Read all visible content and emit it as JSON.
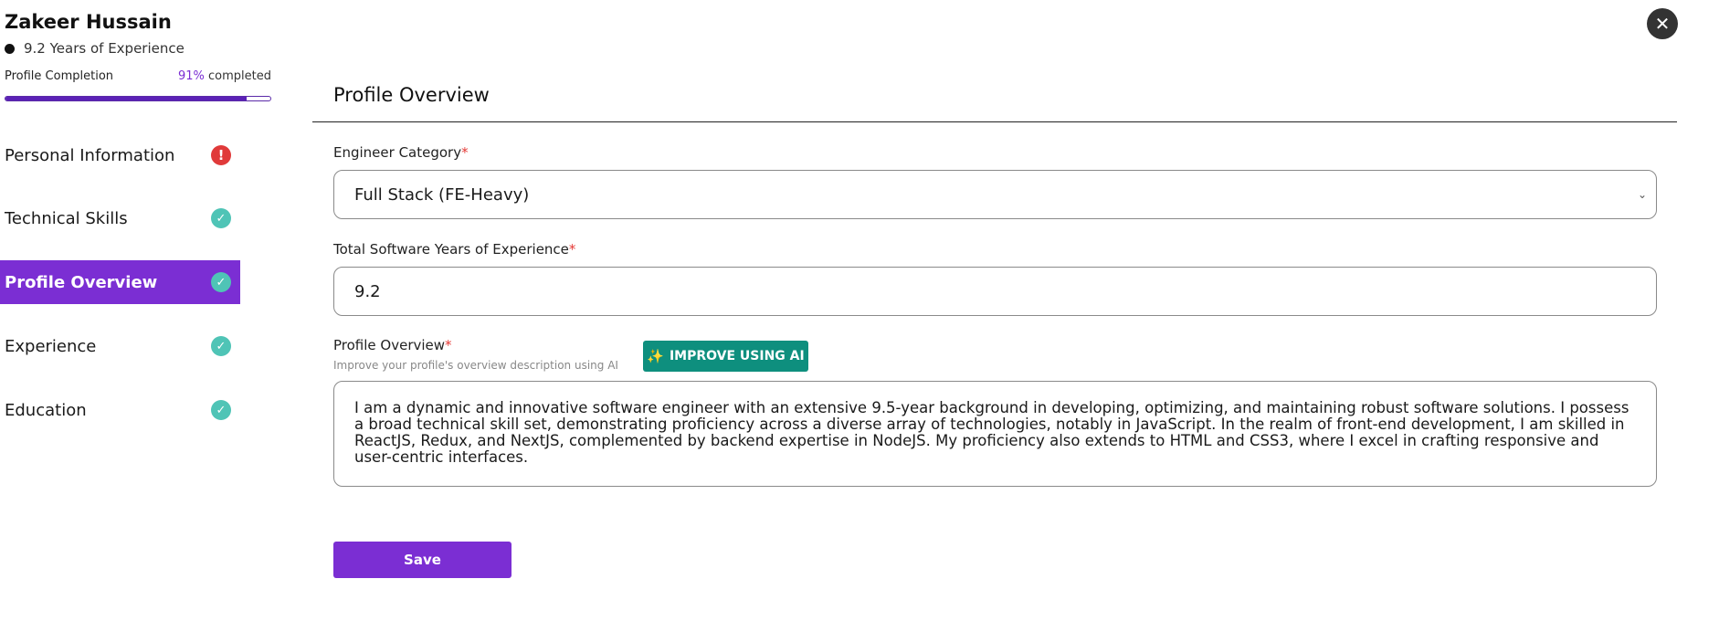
{
  "profile": {
    "name": "Zakeer Hussain",
    "experience": "9.2 Years of Experience",
    "completion_label": "Profile Completion",
    "completion_percent": "91%",
    "completion_suffix": " completed",
    "completion_fraction": 0.91
  },
  "sidebar": {
    "items": [
      {
        "label": "Personal Information",
        "status": "warning",
        "icon": "alert-icon"
      },
      {
        "label": "Technical Skills",
        "status": "complete",
        "icon": "check-circle-icon"
      },
      {
        "label": "Profile Overview",
        "status": "complete",
        "icon": "check-circle-icon",
        "active": true
      },
      {
        "label": "Experience",
        "status": "complete",
        "icon": "check-circle-icon"
      },
      {
        "label": "Education",
        "status": "complete",
        "icon": "check-circle-icon"
      }
    ]
  },
  "main": {
    "title": "Profile Overview",
    "category": {
      "label": "Engineer Category",
      "required_mark": "*",
      "value": "Full Stack (FE-Heavy)"
    },
    "years": {
      "label": "Total Software Years of Experience",
      "required_mark": "*",
      "value": "9.2"
    },
    "overview": {
      "label": "Profile Overview",
      "required_mark": "*",
      "hint": "Improve your profile's overview description using AI",
      "ai_button_label": "IMPROVE USING AI",
      "ai_icon": "sparkles-icon",
      "value": "I am a dynamic and innovative software engineer with an extensive 9.5-year background in developing, optimizing, and maintaining robust software solutions. I possess a broad technical skill set, demonstrating proficiency across a diverse array of technologies, notably in JavaScript. In the realm of front-end development, I am skilled in ReactJS, Redux, and NextJS, complemented by backend expertise in NodeJS. My proficiency also extends to HTML and CSS3, where I excel in crafting responsive and user-centric interfaces."
    },
    "save_label": "Save"
  },
  "colors": {
    "accent": "#7b2ed3",
    "ai_button": "#0e8f7e",
    "check": "#4fc4b6",
    "warning": "#e03a3a",
    "required": "#e53935"
  }
}
